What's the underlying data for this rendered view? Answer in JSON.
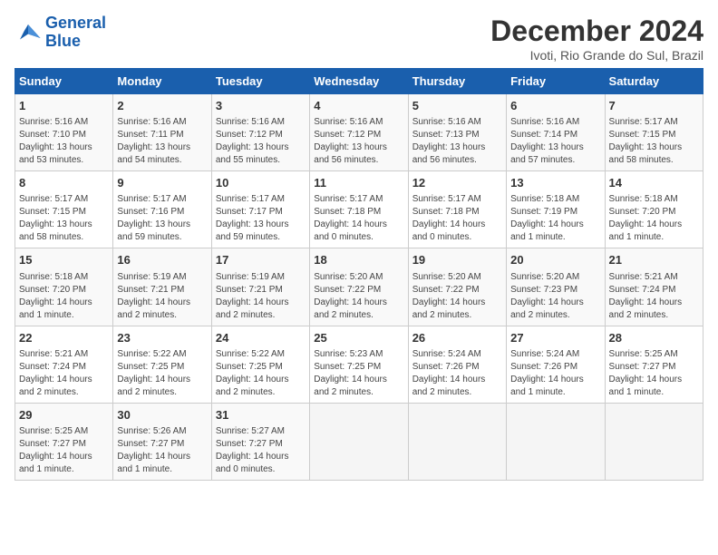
{
  "logo": {
    "line1": "General",
    "line2": "Blue"
  },
  "title": "December 2024",
  "subtitle": "Ivoti, Rio Grande do Sul, Brazil",
  "days_of_week": [
    "Sunday",
    "Monday",
    "Tuesday",
    "Wednesday",
    "Thursday",
    "Friday",
    "Saturday"
  ],
  "weeks": [
    [
      {
        "day": "1",
        "info": "Sunrise: 5:16 AM\nSunset: 7:10 PM\nDaylight: 13 hours\nand 53 minutes."
      },
      {
        "day": "2",
        "info": "Sunrise: 5:16 AM\nSunset: 7:11 PM\nDaylight: 13 hours\nand 54 minutes."
      },
      {
        "day": "3",
        "info": "Sunrise: 5:16 AM\nSunset: 7:12 PM\nDaylight: 13 hours\nand 55 minutes."
      },
      {
        "day": "4",
        "info": "Sunrise: 5:16 AM\nSunset: 7:12 PM\nDaylight: 13 hours\nand 56 minutes."
      },
      {
        "day": "5",
        "info": "Sunrise: 5:16 AM\nSunset: 7:13 PM\nDaylight: 13 hours\nand 56 minutes."
      },
      {
        "day": "6",
        "info": "Sunrise: 5:16 AM\nSunset: 7:14 PM\nDaylight: 13 hours\nand 57 minutes."
      },
      {
        "day": "7",
        "info": "Sunrise: 5:17 AM\nSunset: 7:15 PM\nDaylight: 13 hours\nand 58 minutes."
      }
    ],
    [
      {
        "day": "8",
        "info": "Sunrise: 5:17 AM\nSunset: 7:15 PM\nDaylight: 13 hours\nand 58 minutes."
      },
      {
        "day": "9",
        "info": "Sunrise: 5:17 AM\nSunset: 7:16 PM\nDaylight: 13 hours\nand 59 minutes."
      },
      {
        "day": "10",
        "info": "Sunrise: 5:17 AM\nSunset: 7:17 PM\nDaylight: 13 hours\nand 59 minutes."
      },
      {
        "day": "11",
        "info": "Sunrise: 5:17 AM\nSunset: 7:18 PM\nDaylight: 14 hours\nand 0 minutes."
      },
      {
        "day": "12",
        "info": "Sunrise: 5:17 AM\nSunset: 7:18 PM\nDaylight: 14 hours\nand 0 minutes."
      },
      {
        "day": "13",
        "info": "Sunrise: 5:18 AM\nSunset: 7:19 PM\nDaylight: 14 hours\nand 1 minute."
      },
      {
        "day": "14",
        "info": "Sunrise: 5:18 AM\nSunset: 7:20 PM\nDaylight: 14 hours\nand 1 minute."
      }
    ],
    [
      {
        "day": "15",
        "info": "Sunrise: 5:18 AM\nSunset: 7:20 PM\nDaylight: 14 hours\nand 1 minute."
      },
      {
        "day": "16",
        "info": "Sunrise: 5:19 AM\nSunset: 7:21 PM\nDaylight: 14 hours\nand 2 minutes."
      },
      {
        "day": "17",
        "info": "Sunrise: 5:19 AM\nSunset: 7:21 PM\nDaylight: 14 hours\nand 2 minutes."
      },
      {
        "day": "18",
        "info": "Sunrise: 5:20 AM\nSunset: 7:22 PM\nDaylight: 14 hours\nand 2 minutes."
      },
      {
        "day": "19",
        "info": "Sunrise: 5:20 AM\nSunset: 7:22 PM\nDaylight: 14 hours\nand 2 minutes."
      },
      {
        "day": "20",
        "info": "Sunrise: 5:20 AM\nSunset: 7:23 PM\nDaylight: 14 hours\nand 2 minutes."
      },
      {
        "day": "21",
        "info": "Sunrise: 5:21 AM\nSunset: 7:24 PM\nDaylight: 14 hours\nand 2 minutes."
      }
    ],
    [
      {
        "day": "22",
        "info": "Sunrise: 5:21 AM\nSunset: 7:24 PM\nDaylight: 14 hours\nand 2 minutes."
      },
      {
        "day": "23",
        "info": "Sunrise: 5:22 AM\nSunset: 7:25 PM\nDaylight: 14 hours\nand 2 minutes."
      },
      {
        "day": "24",
        "info": "Sunrise: 5:22 AM\nSunset: 7:25 PM\nDaylight: 14 hours\nand 2 minutes."
      },
      {
        "day": "25",
        "info": "Sunrise: 5:23 AM\nSunset: 7:25 PM\nDaylight: 14 hours\nand 2 minutes."
      },
      {
        "day": "26",
        "info": "Sunrise: 5:24 AM\nSunset: 7:26 PM\nDaylight: 14 hours\nand 2 minutes."
      },
      {
        "day": "27",
        "info": "Sunrise: 5:24 AM\nSunset: 7:26 PM\nDaylight: 14 hours\nand 1 minute."
      },
      {
        "day": "28",
        "info": "Sunrise: 5:25 AM\nSunset: 7:27 PM\nDaylight: 14 hours\nand 1 minute."
      }
    ],
    [
      {
        "day": "29",
        "info": "Sunrise: 5:25 AM\nSunset: 7:27 PM\nDaylight: 14 hours\nand 1 minute."
      },
      {
        "day": "30",
        "info": "Sunrise: 5:26 AM\nSunset: 7:27 PM\nDaylight: 14 hours\nand 1 minute."
      },
      {
        "day": "31",
        "info": "Sunrise: 5:27 AM\nSunset: 7:27 PM\nDaylight: 14 hours\nand 0 minutes."
      },
      {
        "day": "",
        "info": ""
      },
      {
        "day": "",
        "info": ""
      },
      {
        "day": "",
        "info": ""
      },
      {
        "day": "",
        "info": ""
      }
    ]
  ]
}
